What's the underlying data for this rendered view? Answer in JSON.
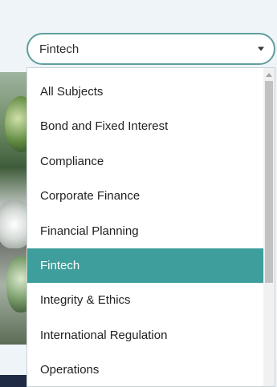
{
  "select": {
    "value": "Fintech"
  },
  "dropdown": {
    "options": [
      {
        "label": "All Subjects",
        "selected": false
      },
      {
        "label": "Bond and Fixed Interest",
        "selected": false
      },
      {
        "label": "Compliance",
        "selected": false
      },
      {
        "label": "Corporate Finance",
        "selected": false
      },
      {
        "label": "Financial Planning",
        "selected": false
      },
      {
        "label": "Fintech",
        "selected": true
      },
      {
        "label": "Integrity & Ethics",
        "selected": false
      },
      {
        "label": "International Regulation",
        "selected": false
      },
      {
        "label": "Operations",
        "selected": false
      }
    ]
  },
  "colors": {
    "accent": "#3d9e9c",
    "select_border": "#5e9f9d",
    "background": "#eef4f7"
  },
  "icons": {
    "select_caret": "caret-down-icon",
    "scroll_up": "arrow-up-icon"
  }
}
